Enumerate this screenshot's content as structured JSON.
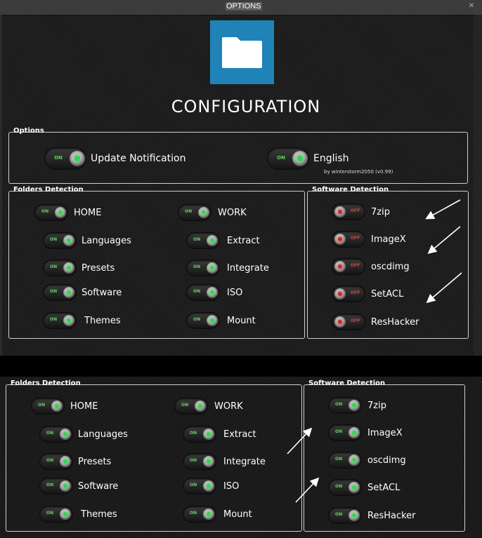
{
  "window": {
    "title": "OPTIONS",
    "close": "✕"
  },
  "header": {
    "title": "CONFIGURATION",
    "logo_icon": "folder-icon",
    "logo_color": "#1f83b7"
  },
  "options": {
    "legend": "Options",
    "items": [
      {
        "label": "Update Notification",
        "state": "ON"
      },
      {
        "label": "English",
        "state": "ON"
      }
    ],
    "credit": "by winterstorm2050 (v0.99)"
  },
  "folders": {
    "legend": "Folders Detection",
    "items": [
      {
        "label": "HOME",
        "state": "ON"
      },
      {
        "label": "WORK",
        "state": "ON"
      },
      {
        "label": "Languages",
        "state": "ON"
      },
      {
        "label": "Extract",
        "state": "ON"
      },
      {
        "label": "Presets",
        "state": "ON"
      },
      {
        "label": "Integrate",
        "state": "ON"
      },
      {
        "label": "Software",
        "state": "ON"
      },
      {
        "label": "ISO",
        "state": "ON"
      },
      {
        "label": "Themes",
        "state": "ON"
      },
      {
        "label": "Mount",
        "state": "ON"
      }
    ]
  },
  "software": {
    "legend": "Software Detection",
    "items": [
      {
        "label": "7zip",
        "state": "OFF"
      },
      {
        "label": "ImageX",
        "state": "OFF"
      },
      {
        "label": "oscdimg",
        "state": "OFF"
      },
      {
        "label": "SetACL",
        "state": "OFF"
      },
      {
        "label": "ResHacker",
        "state": "OFF"
      }
    ]
  },
  "folders2": {
    "legend": "Folders Detection",
    "items": [
      {
        "label": "HOME",
        "state": "ON"
      },
      {
        "label": "WORK",
        "state": "ON"
      },
      {
        "label": "Languages",
        "state": "ON"
      },
      {
        "label": "Extract",
        "state": "ON"
      },
      {
        "label": "Presets",
        "state": "ON"
      },
      {
        "label": "Integrate",
        "state": "ON"
      },
      {
        "label": "Software",
        "state": "ON"
      },
      {
        "label": "ISO",
        "state": "ON"
      },
      {
        "label": "Themes",
        "state": "ON"
      },
      {
        "label": "Mount",
        "state": "ON"
      }
    ]
  },
  "software2": {
    "legend": "Software Detection",
    "items": [
      {
        "label": "7zip",
        "state": "ON"
      },
      {
        "label": "ImageX",
        "state": "ON"
      },
      {
        "label": "oscdimg",
        "state": "ON"
      },
      {
        "label": "SetACL",
        "state": "ON"
      },
      {
        "label": "ResHacker",
        "state": "ON"
      }
    ]
  },
  "colors": {
    "on": "#5fd35f",
    "off": "#e04040",
    "accent": "#1f83b7"
  }
}
